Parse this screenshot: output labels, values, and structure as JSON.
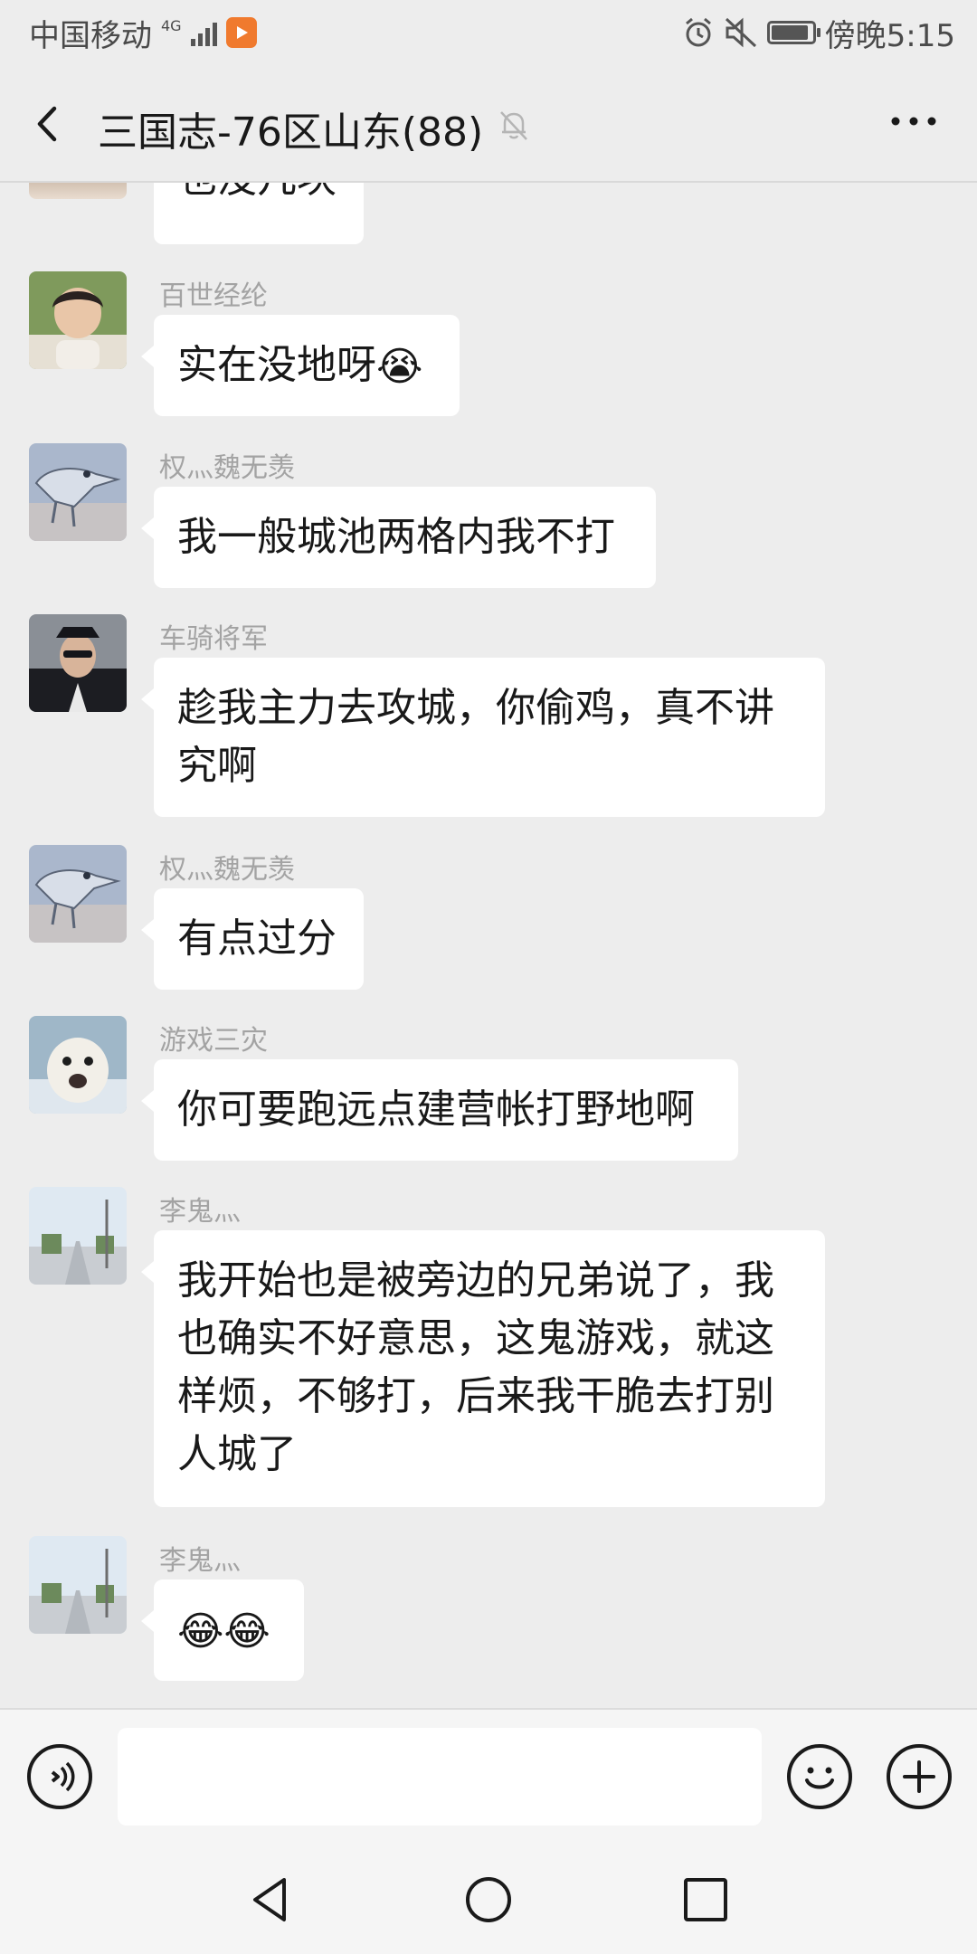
{
  "status_bar": {
    "carrier": "中国移动",
    "network": "4G",
    "time": "傍晚5:15",
    "battery_level": 0.9
  },
  "header": {
    "title": "三国志-76区山东(88)",
    "icons": [
      "back-icon",
      "mute-bell-icon",
      "more-icon"
    ]
  },
  "messages": [
    {
      "sender": "",
      "text": "也没几块",
      "avatar": "avatar-partial"
    },
    {
      "sender": "百世经纶",
      "text": "实在没地呀",
      "emoji": "😭",
      "avatar": "avatar-child"
    },
    {
      "sender": "权灬魏无羡",
      "text": "我一般城池两格内我不打",
      "avatar": "avatar-croc"
    },
    {
      "sender": "车骑将军",
      "text": "趁我主力去攻城，你偷鸡，真不讲究啊",
      "avatar": "avatar-officer"
    },
    {
      "sender": "权灬魏无羡",
      "text": "有点过分",
      "avatar": "avatar-croc"
    },
    {
      "sender": "游戏三灾",
      "text": "你可要跑远点建营帐打野地啊",
      "avatar": "avatar-seal"
    },
    {
      "sender": "李鬼灬",
      "text": "我开始也是被旁边的兄弟说了，我也确实不好意思，这鬼游戏，就这样烦，不够打，后来我干脆去打别人城了",
      "avatar": "avatar-street"
    },
    {
      "sender": "李鬼灬",
      "text": "",
      "emoji": "😂😂",
      "avatar": "avatar-street"
    }
  ],
  "input_bar": {
    "placeholder": "",
    "icons": [
      "voice-icon",
      "emoji-icon",
      "plus-icon"
    ]
  },
  "nav_bar": {
    "icons": [
      "nav-back-icon",
      "nav-home-icon",
      "nav-recents-icon"
    ]
  },
  "colors": {
    "background": "#ededed",
    "bubble": "#ffffff",
    "sender_name": "#a3a3a3",
    "text": "#191919",
    "orange_badge": "#f07a2e"
  }
}
